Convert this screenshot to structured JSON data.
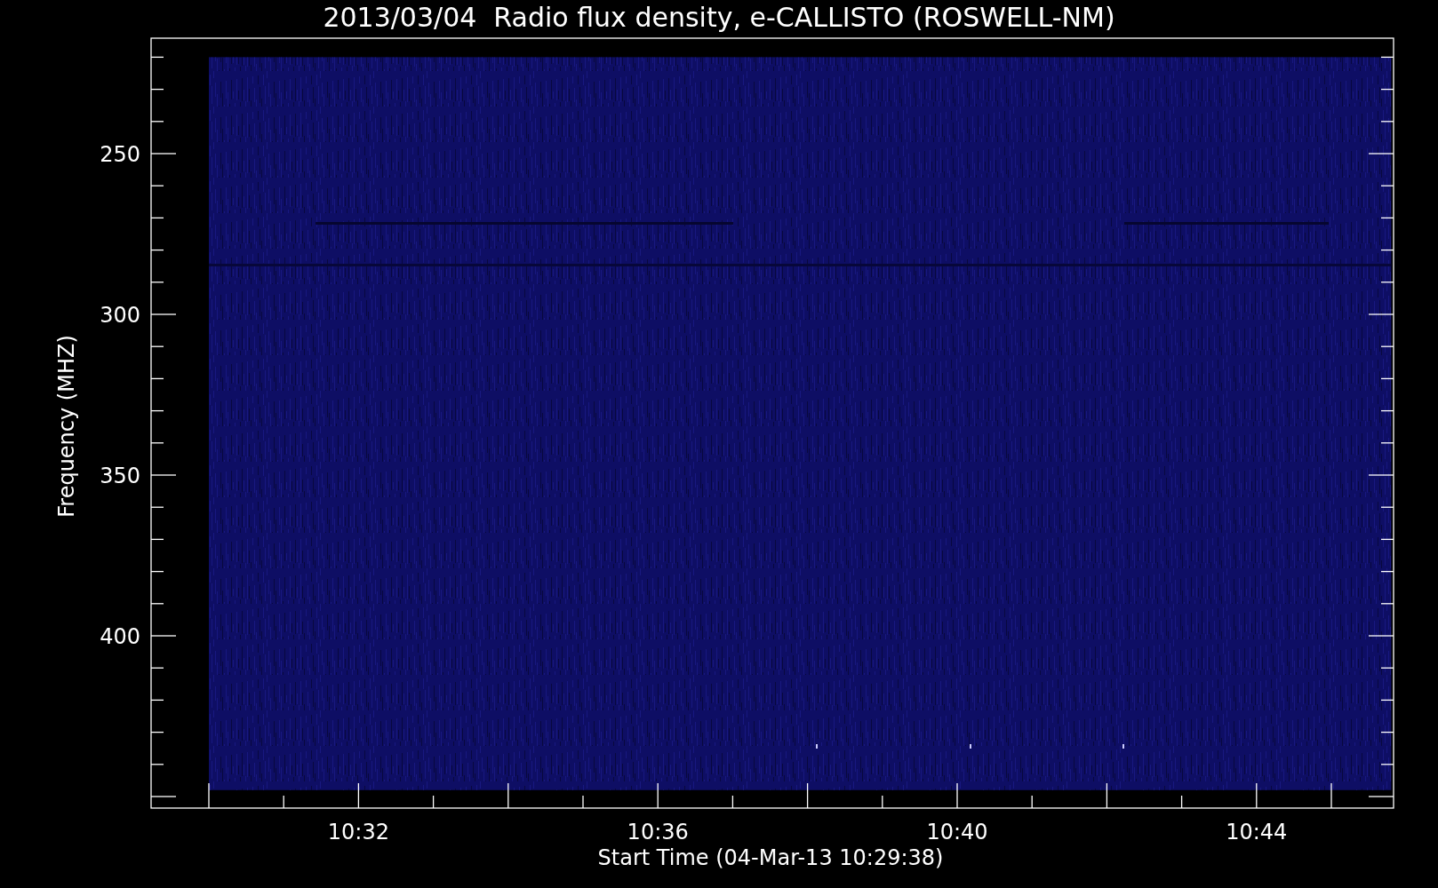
{
  "title": "2013/03/04  Radio flux density, e-CALLISTO (ROSWELL-NM)",
  "y_axis": {
    "label": "Frequency (MHZ)",
    "ticks": [
      "250",
      "300",
      "350",
      "400"
    ]
  },
  "x_axis": {
    "label": "Start Time (04-Mar-13 10:29:38)",
    "ticks": [
      "10:32",
      "10:36",
      "10:40",
      "10:44"
    ]
  }
}
